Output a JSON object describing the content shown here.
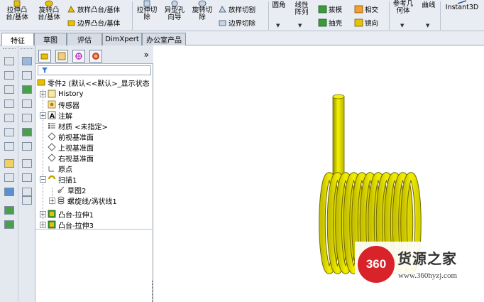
{
  "ribbon": {
    "extrude_boss_base": "拉伸凸台/基体",
    "revolve_boss_base": "旋转凸台/基体",
    "loft_boss_base": "放样凸台/基体",
    "boundary_boss_base": "边界凸台/基体",
    "extrude_cut": "拉伸切除",
    "hole_wizard": "异型孔向导",
    "revolve_cut": "旋转切除",
    "loft_cut": "放样切割",
    "boundary_cut": "边界切除",
    "fillet": "圆角",
    "linear_pattern": "线性阵列",
    "draft": "拔模",
    "intersect": "相交",
    "shell": "抽壳",
    "mirror": "镜向",
    "reference_geometry": "参考几何体",
    "curves": "曲线",
    "instant3d": "Instant3D"
  },
  "tabs": [
    "特征",
    "草图",
    "评估",
    "DimXpert",
    "办公室产品"
  ],
  "feature_tree": {
    "root": "零件2 (默认<<默认>_显示状态",
    "items": [
      "History",
      "传感器",
      "注解",
      "材质 <未指定>",
      "前视基准面",
      "上视基准面",
      "右视基准面",
      "原点",
      "扫描1",
      "草图2",
      "螺旋线/涡状线1",
      "凸台-拉伸1",
      "凸台-拉伸3"
    ]
  },
  "fm_chevron": "»",
  "watermark": {
    "logo": "360",
    "title": "货源之家",
    "url": "www.360hyzj.com"
  },
  "colors": {
    "spring": "#e6e100",
    "spring_shadow": "#8f8a00",
    "ribbon_bg": "#e9edf3",
    "logo_red": "#d8232a"
  }
}
